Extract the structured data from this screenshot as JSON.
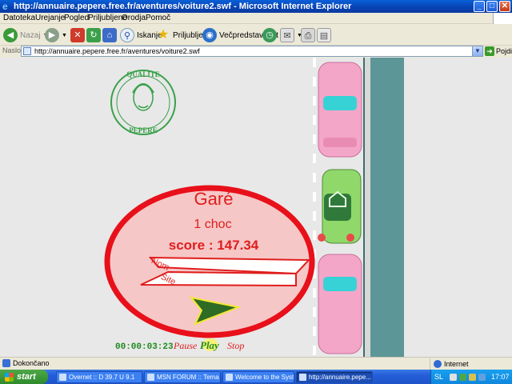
{
  "window": {
    "title": "http://annuaire.pepere.free.fr/aventures/voiture2.swf - Microsoft Internet Explorer",
    "minimize": "_",
    "maximize": "□",
    "close": "✕"
  },
  "menu": [
    "Datoteka",
    "Urejanje",
    "Pogled",
    "Priljubljene",
    "Orodja",
    "Pomoč"
  ],
  "toolbar": {
    "back_label": "Nazaj",
    "search_label": "Iskanje",
    "favorites_label": "Priljubljene",
    "media_label": "Večpredstavnost"
  },
  "address": {
    "label": "Naslov",
    "url": "http://annuaire.pepere.free.fr/aventures/voiture2.swf",
    "go_label": "Pojdi"
  },
  "game": {
    "logo_top_text": "QUALITE",
    "logo_bottom_text": "PEPERE",
    "title": "Garé",
    "chocs": "1 choc",
    "score": "score : 147.34",
    "name_label": "Nom",
    "site_label": "Site",
    "timer": "00:00:03:23",
    "pause_label": "Pause",
    "play_label": "Play",
    "stop_label": "Stop",
    "colors": {
      "ellipse_border": "#e8101a",
      "ellipse_fill": "#f6c7c7",
      "title_red": "#e01d1d",
      "road": "#5d9696",
      "pink_car": "#f3a6c8",
      "green_car": "#90d86a"
    }
  },
  "status": {
    "left": "Dokončano",
    "zone": "Internet"
  },
  "taskbar": {
    "start": "start",
    "tasks": [
      "Overnet :: D 39.7 U 9.1",
      "MSN FORUM :: Tema ...",
      "Welcome to the Syst...",
      "http://annuaire.pepe..."
    ],
    "lang": "SL",
    "clock": "17:07"
  }
}
